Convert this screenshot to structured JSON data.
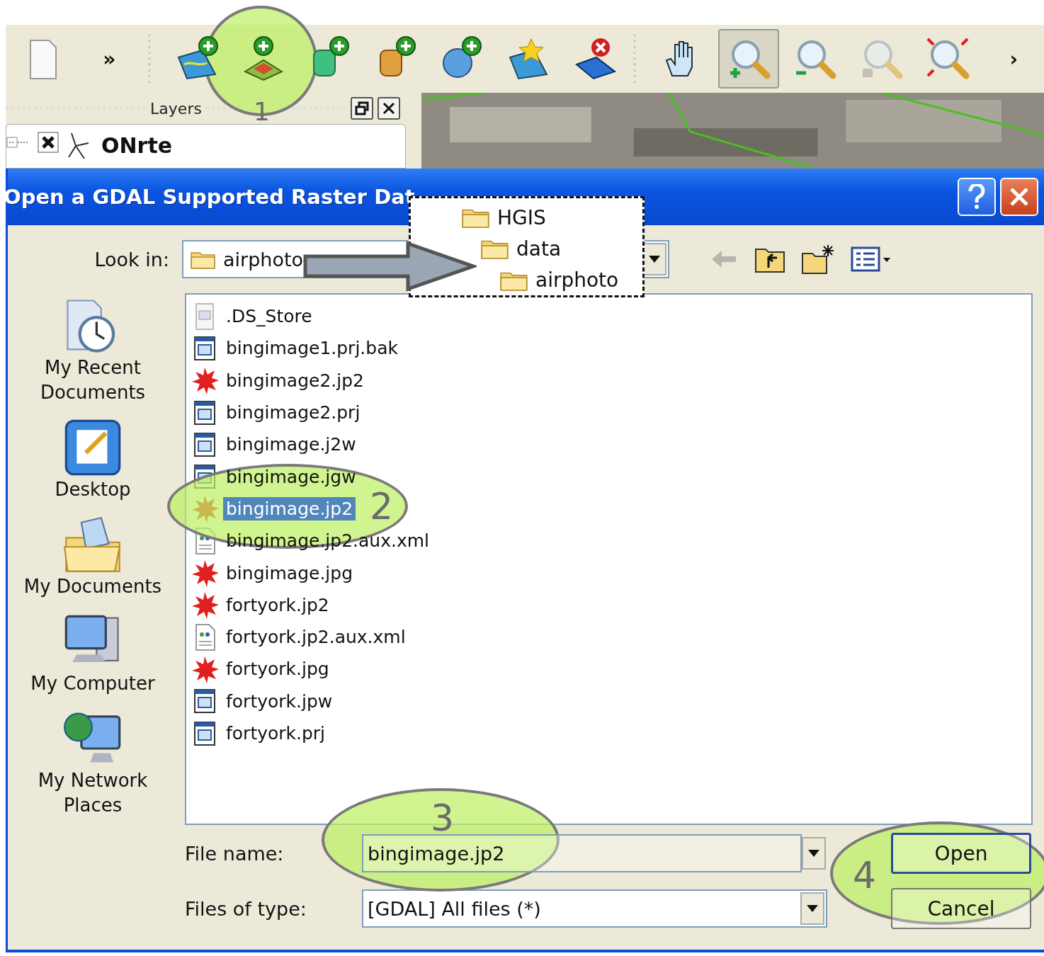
{
  "toolbar": [
    {
      "kind": "new-document",
      "pressed": false
    },
    {
      "kind": "overflow",
      "text": "»",
      "pressed": false
    },
    {
      "kind": "separator"
    },
    {
      "kind": "add-vector",
      "pressed": false
    },
    {
      "kind": "add-raster",
      "pressed": false
    },
    {
      "kind": "add-database",
      "pressed": false
    },
    {
      "kind": "add-spatialite",
      "pressed": false
    },
    {
      "kind": "add-globe",
      "pressed": false
    },
    {
      "kind": "new-layer",
      "pressed": false
    },
    {
      "kind": "remove-layer",
      "pressed": false
    },
    {
      "kind": "separator"
    },
    {
      "kind": "pan",
      "pressed": false
    },
    {
      "kind": "zoom-in",
      "pressed": true
    },
    {
      "kind": "zoom-out",
      "pressed": false
    },
    {
      "kind": "zoom-last",
      "pressed": false
    },
    {
      "kind": "zoom-full",
      "pressed": false
    },
    {
      "kind": "overflow",
      "text": "›",
      "pressed": false
    }
  ],
  "layers_panel": {
    "title": "Layers",
    "layers": [
      {
        "name": "ONrte",
        "visible": true
      }
    ]
  },
  "dialog": {
    "title": "Open a GDAL Supported Raster Dat",
    "look_in": {
      "label": "Look in:",
      "value": "airphoto"
    },
    "places": [
      {
        "label": "My Recent Documents",
        "kind": "recent"
      },
      {
        "label": "Desktop",
        "kind": "desktop"
      },
      {
        "label": "My Documents",
        "kind": "documents"
      },
      {
        "label": "My Computer",
        "kind": "computer"
      },
      {
        "label": "My Network Places",
        "kind": "network"
      }
    ],
    "files": [
      {
        "name": ".DS_Store",
        "kind": "plain",
        "selected": false
      },
      {
        "name": "bingimage1.prj.bak",
        "kind": "text",
        "selected": false
      },
      {
        "name": "bingimage2.jp2",
        "kind": "raster",
        "selected": false
      },
      {
        "name": "bingimage2.prj",
        "kind": "text",
        "selected": false
      },
      {
        "name": "bingimage.j2w",
        "kind": "text",
        "selected": false
      },
      {
        "name": "bingimage.jgw",
        "kind": "text",
        "selected": false
      },
      {
        "name": "bingimage.jp2",
        "kind": "raster",
        "selected": true
      },
      {
        "name": "bingimage.jp2.aux.xml",
        "kind": "xml",
        "selected": false
      },
      {
        "name": "bingimage.jpg",
        "kind": "raster",
        "selected": false
      },
      {
        "name": "fortyork.jp2",
        "kind": "raster",
        "selected": false
      },
      {
        "name": "fortyork.jp2.aux.xml",
        "kind": "xml",
        "selected": false
      },
      {
        "name": "fortyork.jpg",
        "kind": "raster",
        "selected": false
      },
      {
        "name": "fortyork.jpw",
        "kind": "text",
        "selected": false
      },
      {
        "name": "fortyork.prj",
        "kind": "text",
        "selected": false
      }
    ],
    "file_name": {
      "label": "File name:",
      "value": "bingimage.jp2"
    },
    "file_type": {
      "label": "Files of type:",
      "value": "[GDAL] All files (*)"
    },
    "buttons": [
      {
        "label": "Open",
        "default": true
      },
      {
        "label": "Cancel",
        "default": false
      }
    ]
  },
  "path_callout": {
    "folders": [
      "HGIS",
      "data",
      "airphoto"
    ]
  },
  "annotations": [
    {
      "label": "1"
    },
    {
      "label": "2"
    },
    {
      "label": "3"
    },
    {
      "label": "4"
    }
  ]
}
